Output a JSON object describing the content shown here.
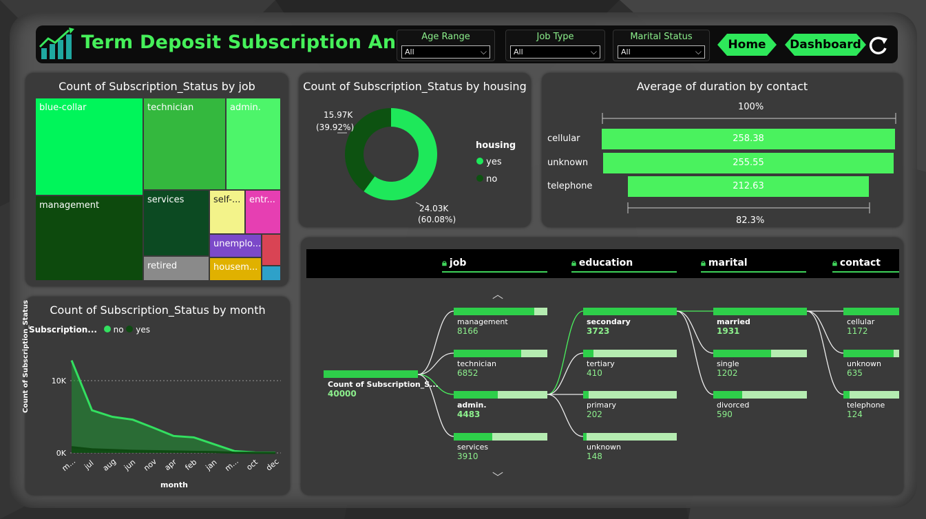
{
  "header": {
    "title": "Term Deposit Subscription Analysis",
    "slicers": [
      {
        "label": "Age Range",
        "value": "All"
      },
      {
        "label": "Job Type",
        "value": "All"
      },
      {
        "label": "Marital Status",
        "value": "All"
      }
    ],
    "nav": {
      "home": "Home",
      "dashboard": "Dashboard"
    },
    "icons": {
      "logo": "growth-chart-icon",
      "refresh": "refresh-icon"
    }
  },
  "treemap": {
    "title": "Count of Subscription_Status by job",
    "tiles": [
      {
        "label": "blue-collar",
        "color": "#00f55a"
      },
      {
        "label": "technician",
        "color": "#34b83e"
      },
      {
        "label": "admin.",
        "color": "#4df56a"
      },
      {
        "label": "management",
        "color": "#0d4a0d"
      },
      {
        "label": "services",
        "color": "#0c4a22"
      },
      {
        "label": "self-...",
        "color": "#f3f38a"
      },
      {
        "label": "entr...",
        "color": "#e63fb2"
      },
      {
        "label": "unemplo...",
        "color": "#7b49c9"
      },
      {
        "label": "retired",
        "color": "#8a8a8a"
      },
      {
        "label": "housem...",
        "color": "#e0b100"
      },
      {
        "label": "",
        "color": "#d94454"
      },
      {
        "label": "",
        "color": "#2ea1c9"
      }
    ]
  },
  "donut": {
    "title": "Count of Subscription_Status by housing",
    "legend_title": "housing",
    "slices": [
      {
        "name": "yes",
        "value": 24030,
        "label": "24.03K",
        "pct": "(60.08%)",
        "color": "#1ee85a"
      },
      {
        "name": "no",
        "value": 15970,
        "label": "15.97K",
        "pct": "(39.92%)",
        "color": "#0d5211"
      }
    ]
  },
  "funnel": {
    "title": "Average of duration by contact",
    "top_pct": "100%",
    "bottom_pct": "82.3%",
    "categories": [
      "cellular",
      "unknown",
      "telephone"
    ],
    "values": [
      258.38,
      255.55,
      212.63
    ],
    "value_labels": [
      "258.38",
      "255.55",
      "212.63"
    ]
  },
  "area": {
    "title": "Count of Subscription_Status by month",
    "legend_title": "Subscription...",
    "legend": [
      {
        "name": "no",
        "color": "#33e060"
      },
      {
        "name": "yes",
        "color": "#0e4a12"
      }
    ],
    "xlabel": "month",
    "ylabel": "Count of Subscription_Status",
    "yticks": [
      "10K",
      "0K"
    ]
  },
  "chart_data": {
    "type": "area",
    "title": "Count of Subscription_Status by month",
    "xlabel": "month",
    "ylabel": "Count of Subscription_Status",
    "categories": [
      "m...",
      "jul",
      "aug",
      "jun",
      "nov",
      "apr",
      "feb",
      "jan",
      "m...",
      "oct",
      "dec"
    ],
    "ylim": [
      0,
      14000
    ],
    "series": [
      {
        "name": "no",
        "values": [
          12800,
          5900,
          5000,
          4600,
          3500,
          2350,
          2150,
          1200,
          250,
          60,
          40
        ]
      },
      {
        "name": "yes",
        "values": [
          800,
          500,
          400,
          300,
          250,
          200,
          150,
          120,
          30,
          10,
          5
        ]
      }
    ],
    "grid": true,
    "legend": "top-left"
  },
  "decomp": {
    "columns": [
      "job",
      "education",
      "marital",
      "contact"
    ],
    "root": {
      "label": "Count of Subscription_S...",
      "value": "40000"
    },
    "job": [
      {
        "label": "management",
        "value": "8166",
        "fill": 0.86
      },
      {
        "label": "technician",
        "value": "6852",
        "fill": 0.72
      },
      {
        "label": "admin.",
        "value": "4483",
        "fill": 0.47,
        "selected": true
      },
      {
        "label": "services",
        "value": "3910",
        "fill": 0.41
      }
    ],
    "education": [
      {
        "label": "secondary",
        "value": "3723",
        "fill": 1.0,
        "selected": true
      },
      {
        "label": "tertiary",
        "value": "410",
        "fill": 0.11
      },
      {
        "label": "primary",
        "value": "202",
        "fill": 0.06
      },
      {
        "label": "unknown",
        "value": "148",
        "fill": 0.04
      }
    ],
    "marital": [
      {
        "label": "married",
        "value": "1931",
        "fill": 1.0,
        "selected": true
      },
      {
        "label": "single",
        "value": "1202",
        "fill": 0.62
      },
      {
        "label": "divorced",
        "value": "590",
        "fill": 0.31
      }
    ],
    "contact": [
      {
        "label": "cellular",
        "value": "1172",
        "fill": 1.0
      },
      {
        "label": "unknown",
        "value": "635",
        "fill": 0.9
      },
      {
        "label": "telephone",
        "value": "124",
        "fill": 0.11
      }
    ]
  }
}
